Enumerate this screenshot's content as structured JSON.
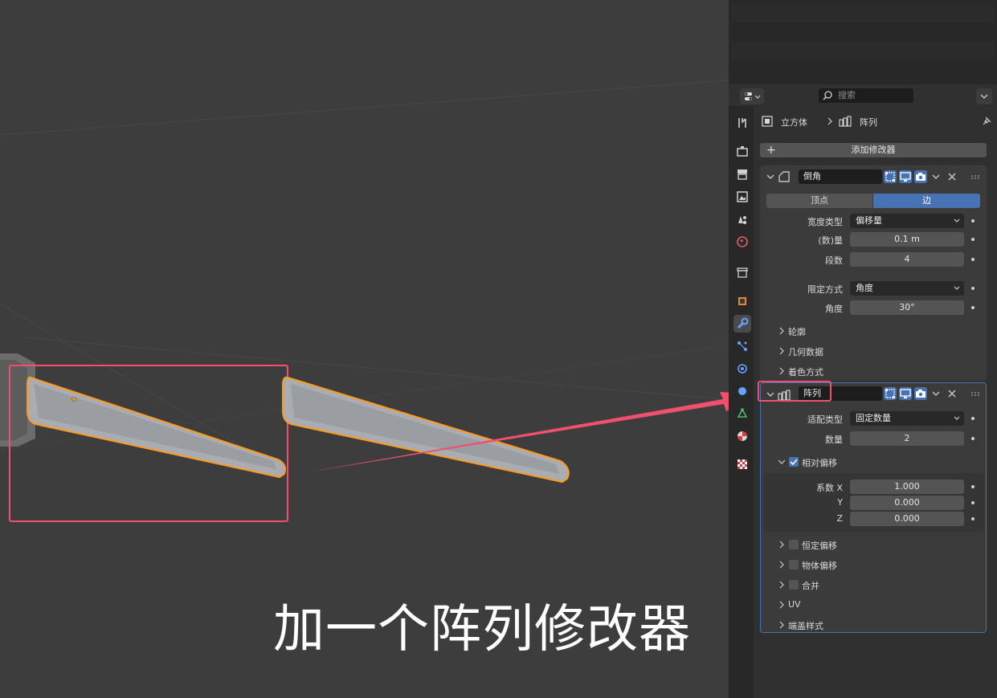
{
  "viewport": {
    "caption": "加一个阵列修改器"
  },
  "header": {
    "search_placeholder": "搜索"
  },
  "breadcrumb": {
    "object": "立方体",
    "modifier": "阵列"
  },
  "add_modifier_label": "添加修改器",
  "bevel": {
    "name": "倒角",
    "tab_vertex": "顶点",
    "tab_edge": "边",
    "width_type_label": "宽度类型",
    "width_type_value": "偏移量",
    "amount_label": "(数)量",
    "amount_value": "0.1 m",
    "segments_label": "段数",
    "segments_value": "4",
    "limit_method_label": "限定方式",
    "limit_method_value": "角度",
    "angle_label": "角度",
    "angle_value": "30°",
    "sub_profile": "轮廓",
    "sub_geometry": "几何数据",
    "sub_shading": "着色方式"
  },
  "array": {
    "name": "阵列",
    "fit_type_label": "适配类型",
    "fit_type_value": "固定数量",
    "count_label": "数量",
    "count_value": "2",
    "relative_offset_label": "相对偏移",
    "factor_x_label": "系数 X",
    "factor_x_value": "1.000",
    "y_label": "Y",
    "y_value": "0.000",
    "z_label": "Z",
    "z_value": "0.000",
    "constant_offset": "恒定偏移",
    "object_offset": "物体偏移",
    "merge": "合并",
    "uv": "UV",
    "caps": "端盖样式"
  },
  "colors": {
    "accent": "#4772b3",
    "highlight_red": "#f0506e",
    "selection_orange": "#ff9a1f"
  }
}
